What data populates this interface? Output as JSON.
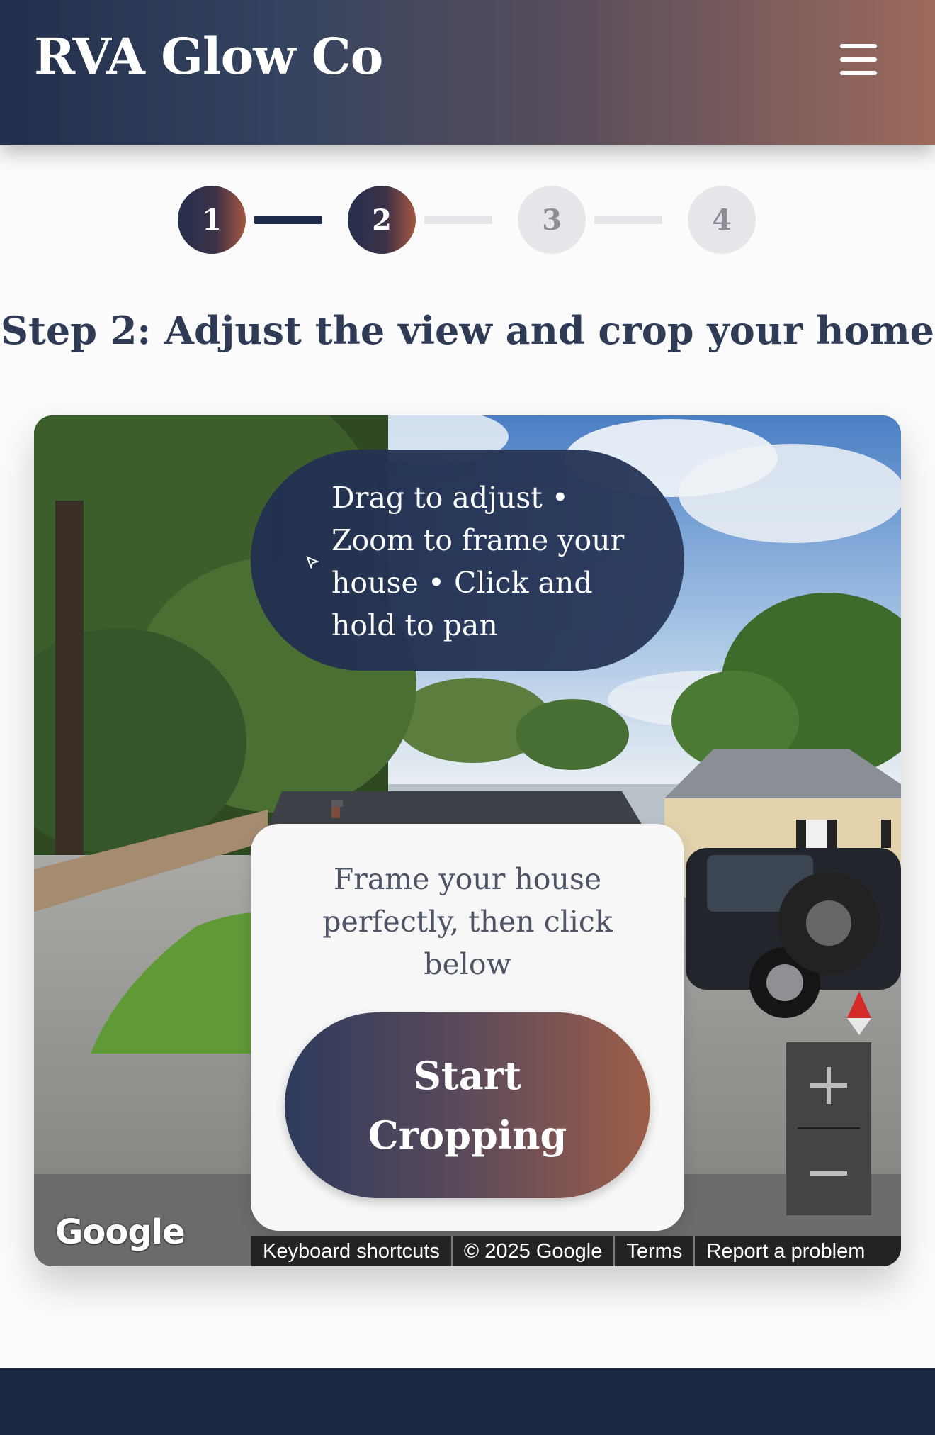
{
  "header": {
    "brand": "RVA Glow Co",
    "menu_icon": "hamburger-menu-icon"
  },
  "stepper": {
    "current_step": 2,
    "steps": [
      {
        "label": "1",
        "state": "completed"
      },
      {
        "label": "2",
        "state": "active"
      },
      {
        "label": "3",
        "state": "upcoming"
      },
      {
        "label": "4",
        "state": "upcoming"
      }
    ]
  },
  "page_title": "Step 2: Adjust the view and crop your home",
  "map": {
    "hint": "Drag to adjust • Zoom to frame your house • Click and hold to pan",
    "crop_card": {
      "instruction": "Frame your house perfectly, then click below",
      "button_label": "Start Cropping"
    },
    "controls": {
      "pegman_icon": "pegman-icon",
      "compass_icon": "compass-icon",
      "zoom_in_icon": "plus-icon",
      "zoom_out_icon": "minus-icon"
    },
    "google_logo": "Google",
    "attribution": {
      "keyboard": "Keyboard shortcuts",
      "copyright": "© 2025 Google",
      "terms": "Terms",
      "report": "Report a problem"
    }
  },
  "colors": {
    "header_gradient_start": "#232f4c",
    "header_gradient_end": "#9d6a5c",
    "navy": "#1e2a48",
    "accent": "#a4573f",
    "footer": "#1b2643"
  }
}
